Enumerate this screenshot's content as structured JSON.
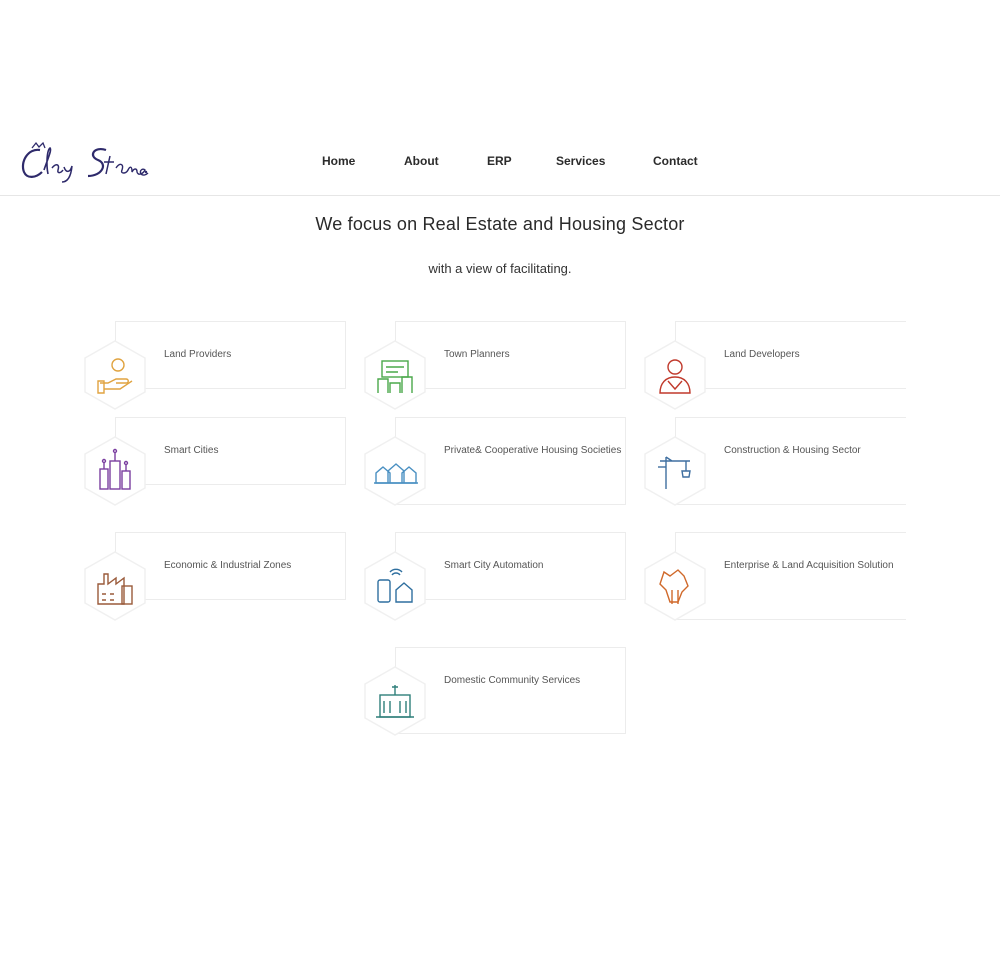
{
  "brand": {
    "logo_text": "Clay Stone.",
    "color": "#2e2a6b"
  },
  "nav": {
    "home": "Home",
    "about": "About",
    "erp": "ERP",
    "services": "Services",
    "contact": "Contact"
  },
  "headline": "We focus on Real Estate and Housing Sector",
  "subline": "with a view of facilitating.",
  "services": [
    {
      "label": "Land Providers",
      "icon": "hand-coin-icon",
      "color": "#e0a340"
    },
    {
      "label": "Town Planners",
      "icon": "town-planning-icon",
      "color": "#4aa84a"
    },
    {
      "label": "Land Developers",
      "icon": "developer-person-icon",
      "color": "#c0392b"
    },
    {
      "label": "Smart Cities",
      "icon": "smart-city-icon",
      "color": "#7b3fa0"
    },
    {
      "label": "Private& Cooperative Housing Societies",
      "icon": "housing-society-icon",
      "color": "#4a90c2"
    },
    {
      "label": "Construction & Housing Sector",
      "icon": "construction-crane-icon",
      "color": "#3f6fa0"
    },
    {
      "label": "Economic & Industrial Zones",
      "icon": "factory-icon",
      "color": "#9a5a3a"
    },
    {
      "label": "Smart City Automation",
      "icon": "smart-home-automation-icon",
      "color": "#2f6f9f"
    },
    {
      "label": "Enterprise & Land Acquisition Solution",
      "icon": "land-acquisition-icon",
      "color": "#d0692a"
    },
    {
      "label": "Domestic Community Services",
      "icon": "community-building-icon",
      "color": "#2f7f7a"
    }
  ]
}
